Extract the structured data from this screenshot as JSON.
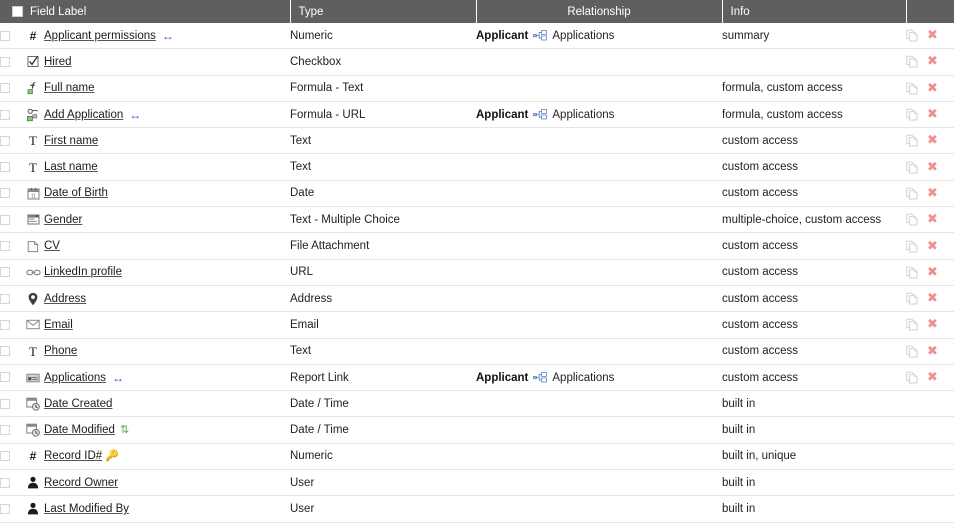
{
  "table": {
    "columns": [
      {
        "key": "select",
        "label": ""
      },
      {
        "key": "field_label",
        "label": "Field Label"
      },
      {
        "key": "type",
        "label": "Type"
      },
      {
        "key": "relationship",
        "label": "Relationship"
      },
      {
        "key": "info",
        "label": "Info"
      },
      {
        "key": "actions",
        "label": ""
      }
    ],
    "colors": {
      "header_background": "#5f5f5f",
      "header_text": "#ffffff",
      "row_border": "#e6e6e6",
      "lookup_arrow": "#2b62d9",
      "sort_arrow": "#49b04a",
      "delete_icon": "#f08f8f",
      "relationship_icon": "#5d86c6"
    },
    "relationship_label": {
      "parent": "Applicant",
      "child": "Applications"
    },
    "actions": {
      "copy_label": "copy-field",
      "delete_label": "delete-field"
    },
    "rows": [
      {
        "name": "Applicant permissions",
        "icon": "numeric-hash-icon",
        "icon_glyph": "#",
        "lookup": true,
        "sortable": false,
        "key": false,
        "type": "Numeric",
        "rel_parent": "Applicant",
        "rel_child": "Applications",
        "info": "summary",
        "has_actions": true
      },
      {
        "name": "Hired",
        "icon": "checkbox-icon",
        "icon_glyph": "☑",
        "lookup": false,
        "sortable": false,
        "key": false,
        "type": "Checkbox",
        "rel_parent": "",
        "rel_child": "",
        "info": "",
        "has_actions": true
      },
      {
        "name": "Full name",
        "icon": "formula-text-icon",
        "icon_glyph": "formula",
        "lookup": false,
        "sortable": false,
        "key": false,
        "type": "Formula - Text",
        "rel_parent": "",
        "rel_child": "",
        "info": "formula, custom access",
        "has_actions": true
      },
      {
        "name": "Add Application",
        "icon": "formula-url-icon",
        "icon_glyph": "formula-url",
        "lookup": true,
        "sortable": false,
        "key": false,
        "type": "Formula - URL",
        "rel_parent": "Applicant",
        "rel_child": "Applications",
        "info": "formula, custom access",
        "has_actions": true
      },
      {
        "name": "First name",
        "icon": "text-icon",
        "icon_glyph": "T",
        "lookup": false,
        "sortable": false,
        "key": false,
        "type": "Text",
        "rel_parent": "",
        "rel_child": "",
        "info": "custom access",
        "has_actions": true
      },
      {
        "name": "Last name",
        "icon": "text-icon",
        "icon_glyph": "T",
        "lookup": false,
        "sortable": false,
        "key": false,
        "type": "Text",
        "rel_parent": "",
        "rel_child": "",
        "info": "custom access",
        "has_actions": true
      },
      {
        "name": "Date of Birth",
        "icon": "calendar-icon",
        "icon_glyph": "calendar",
        "lookup": false,
        "sortable": false,
        "key": false,
        "type": "Date",
        "rel_parent": "",
        "rel_child": "",
        "info": "custom access",
        "has_actions": true
      },
      {
        "name": "Gender",
        "icon": "multiple-choice-icon",
        "icon_glyph": "choice",
        "lookup": false,
        "sortable": false,
        "key": false,
        "type": "Text - Multiple Choice",
        "rel_parent": "",
        "rel_child": "",
        "info": "multiple-choice, custom access",
        "has_actions": true
      },
      {
        "name": "CV",
        "icon": "file-attachment-icon",
        "icon_glyph": "file",
        "lookup": false,
        "sortable": false,
        "key": false,
        "type": "File Attachment",
        "rel_parent": "",
        "rel_child": "",
        "info": "custom access",
        "has_actions": true
      },
      {
        "name": "LinkedIn profile",
        "icon": "url-link-icon",
        "icon_glyph": "link",
        "lookup": false,
        "sortable": false,
        "key": false,
        "type": "URL",
        "rel_parent": "",
        "rel_child": "",
        "info": "custom access",
        "has_actions": true
      },
      {
        "name": "Address",
        "icon": "map-pin-icon",
        "icon_glyph": "pin",
        "lookup": false,
        "sortable": false,
        "key": false,
        "type": "Address",
        "rel_parent": "",
        "rel_child": "",
        "info": "custom access",
        "has_actions": true
      },
      {
        "name": "Email",
        "icon": "envelope-icon",
        "icon_glyph": "envelope",
        "lookup": false,
        "sortable": false,
        "key": false,
        "type": "Email",
        "rel_parent": "",
        "rel_child": "",
        "info": "custom access",
        "has_actions": true
      },
      {
        "name": "Phone",
        "icon": "text-icon",
        "icon_glyph": "T",
        "lookup": false,
        "sortable": false,
        "key": false,
        "type": "Text",
        "rel_parent": "",
        "rel_child": "",
        "info": "custom access",
        "has_actions": true
      },
      {
        "name": "Applications",
        "icon": "report-link-icon",
        "icon_glyph": "report",
        "lookup": true,
        "sortable": false,
        "key": false,
        "type": "Report Link",
        "rel_parent": "Applicant",
        "rel_child": "Applications",
        "info": "custom access",
        "has_actions": true
      },
      {
        "name": "Date Created",
        "icon": "date-time-icon",
        "icon_glyph": "datetime",
        "lookup": false,
        "sortable": false,
        "key": false,
        "type": "Date / Time",
        "rel_parent": "",
        "rel_child": "",
        "info": "built in",
        "has_actions": false
      },
      {
        "name": "Date Modified",
        "icon": "date-time-icon",
        "icon_glyph": "datetime",
        "lookup": false,
        "sortable": true,
        "key": false,
        "type": "Date / Time",
        "rel_parent": "",
        "rel_child": "",
        "info": "built in",
        "has_actions": false
      },
      {
        "name": "Record ID#",
        "icon": "numeric-hash-icon",
        "icon_glyph": "#",
        "lookup": false,
        "sortable": false,
        "key": true,
        "type": "Numeric",
        "rel_parent": "",
        "rel_child": "",
        "info": "built in, unique",
        "has_actions": false
      },
      {
        "name": "Record Owner",
        "icon": "user-icon",
        "icon_glyph": "user",
        "lookup": false,
        "sortable": false,
        "key": false,
        "type": "User",
        "rel_parent": "",
        "rel_child": "",
        "info": "built in",
        "has_actions": false
      },
      {
        "name": "Last Modified By",
        "icon": "user-icon",
        "icon_glyph": "user",
        "lookup": false,
        "sortable": false,
        "key": false,
        "type": "User",
        "rel_parent": "",
        "rel_child": "",
        "info": "built in",
        "has_actions": false
      }
    ]
  }
}
